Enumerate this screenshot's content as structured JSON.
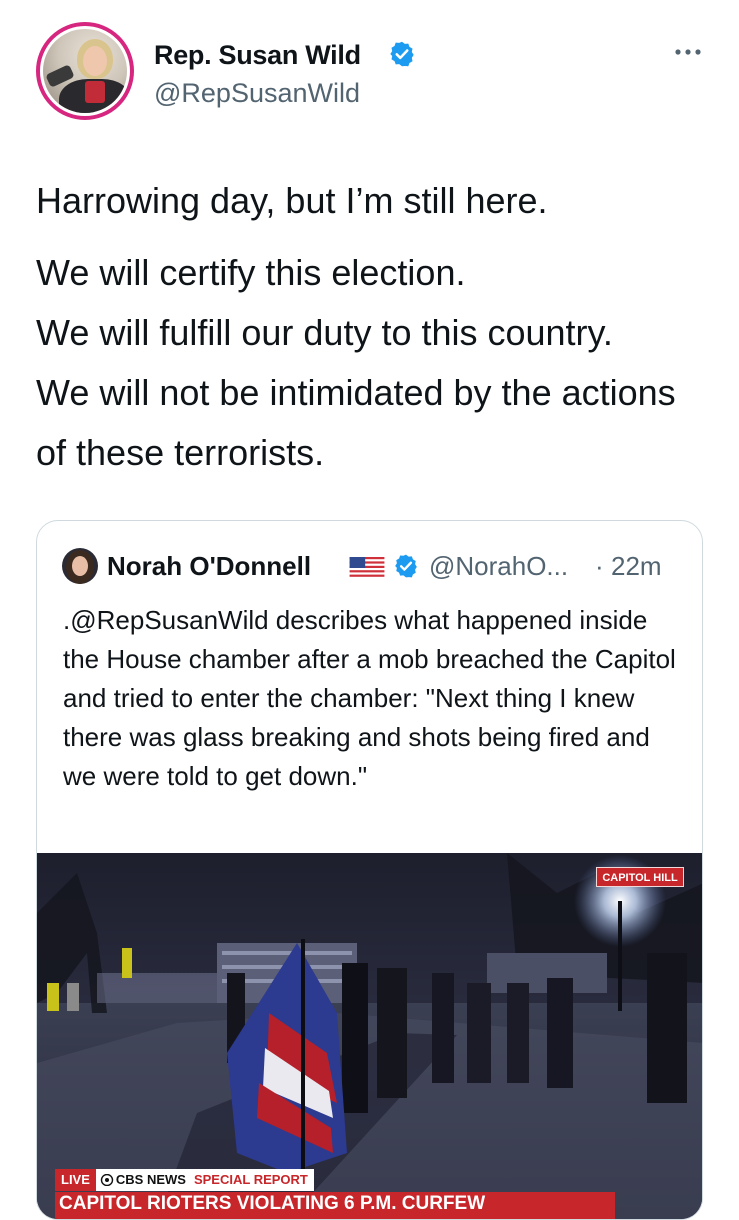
{
  "tweet": {
    "author": {
      "name": "Rep. Susan Wild",
      "handle": "@RepSusanWild"
    },
    "lines": [
      "Harrowing day, but I’m still here.",
      "We will certify this election.",
      "We will fulfill our duty to this country.",
      "We will not be intimidated by the actions of these terrorists."
    ]
  },
  "quote": {
    "author": {
      "name": "Norah O'Donnell",
      "handle": "@NorahO...",
      "separator": "·",
      "time": "22m"
    },
    "text": ".@RepSusanWild describes what happened inside the House chamber after a mob breached the Capitol and tried to enter the chamber: \"Next thing I knew there was glass breaking and shots being fired and we were told to get down.\"",
    "media": {
      "location_tag": "CAPITOL HILL",
      "live_label": "LIVE",
      "network_label": "CBS NEWS",
      "special_label": "SPECIAL REPORT",
      "headline": "CAPITOL RIOTERS VIOLATING 6 P.M. CURFEW"
    }
  },
  "colors": {
    "avatar_ring": "#d6267f",
    "verified_blue": "#1d9bf0",
    "secondary_text": "#536471",
    "cbs_red": "#c7262a"
  }
}
